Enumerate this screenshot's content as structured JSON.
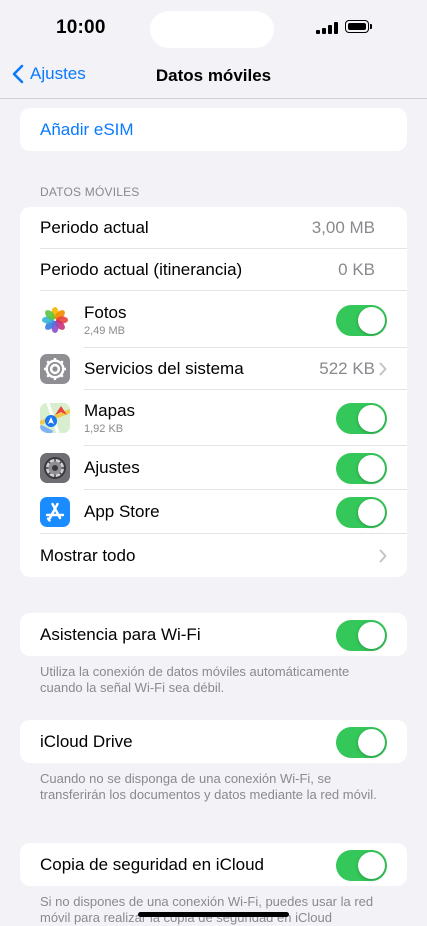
{
  "status": {
    "time": "10:00"
  },
  "nav": {
    "back_label": "Ajustes",
    "title": "Datos móviles"
  },
  "esim": {
    "add_label": "Añadir eSIM"
  },
  "cellular": {
    "header": "DATOS MÓVILES",
    "current_period": {
      "label": "Periodo actual",
      "value": "3,00 MB"
    },
    "roaming_period": {
      "label": "Periodo actual (itinerancia)",
      "value": "0 KB"
    },
    "apps": [
      {
        "name": "Fotos",
        "usage": "2,49 MB",
        "icon": "photos-icon",
        "enabled": true
      },
      {
        "name": "Servicios del sistema",
        "usage": "522 KB",
        "icon": "settings-gear-icon"
      },
      {
        "name": "Mapas",
        "usage": "1,92 KB",
        "icon": "maps-icon",
        "enabled": true
      },
      {
        "name": "Ajustes",
        "icon": "settings-icon",
        "enabled": true
      },
      {
        "name": "App Store",
        "icon": "app-store-icon",
        "enabled": true
      }
    ],
    "show_all_label": "Mostrar todo"
  },
  "wifi_assist": {
    "label": "Asistencia para Wi-Fi",
    "enabled": true,
    "note": "Utiliza la conexión de datos móviles automáticamente cuando la señal Wi-Fi sea débil."
  },
  "icloud_drive": {
    "label": "iCloud Drive",
    "enabled": true,
    "note": "Cuando no se disponga de una conexión Wi-Fi, se transferirán los documentos y datos mediante la red móvil."
  },
  "icloud_backup": {
    "label": "Copia de seguridad en iCloud",
    "enabled": true,
    "note": "Si no dispones de una conexión Wi-Fi, puedes usar la red móvil para realizar la copia de seguridad en iCloud"
  },
  "colors": {
    "accent": "#0a7aff",
    "toggle_on": "#34c759",
    "background": "#f2f2f7",
    "secondary_text": "#8a8a8e"
  }
}
